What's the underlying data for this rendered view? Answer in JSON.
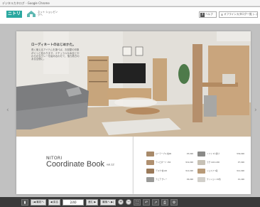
{
  "window": {
    "title": "デジタルカタログ - Google Chrome"
  },
  "header": {
    "logo": "ニトリ",
    "sublogo_text": "ネット ショッピングへ",
    "help_label": "ヘルプ",
    "download_label": "オフラインカタログ一覧 (...)"
  },
  "catalog": {
    "caption_title": "ローディネートのはじめかた。",
    "caption_lines": "長く使えるアイテムを選べば、お部屋の印象がぐっと変わります。ナチュラルな木目とやわらかなグレーを組み合わせて、落ち着きのある空間に。",
    "brand_small": "NITORI",
    "brand_title": "Coordinate Book",
    "brand_vol": "vol.12",
    "items": [
      {
        "name": "ローテーブル 幅90",
        "price": "¥5,990",
        "color": "#a88a6a"
      },
      {
        "name": "ソファ 3人掛け",
        "price": "¥39,990",
        "color": "#8a8a88"
      },
      {
        "name": "テレビボード 150",
        "price": "¥19,990",
        "color": "#b09070"
      },
      {
        "name": "ラグ 140×200",
        "price": "¥7,990",
        "color": "#c7c1b5"
      },
      {
        "name": "デスク 幅120",
        "price": "¥14,990",
        "color": "#9a7a5a"
      },
      {
        "name": "シェルフ 5段",
        "price": "¥12,990",
        "color": "#b89a78"
      },
      {
        "name": "チェア グレー",
        "price": "¥6,990",
        "color": "#9a9a98"
      },
      {
        "name": "クッション 45角",
        "price": "¥1,490",
        "color": "#d2d0cb"
      }
    ]
  },
  "toolbar": {
    "first_label": "最初へ",
    "prev_label": "戻る",
    "page_value": "2/40",
    "next_label": "進む",
    "last_label": "最後へ"
  }
}
